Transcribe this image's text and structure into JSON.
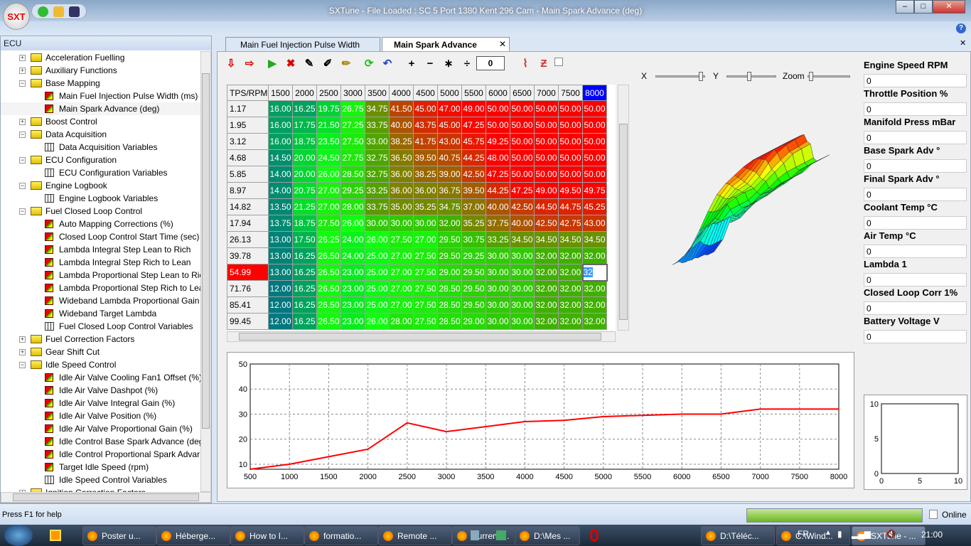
{
  "window": {
    "title": "SXTune - File Loaded :    SC 5 Port 1380 Kent 296 Cam - Main Spark Advance (deg)",
    "logo": "SXT",
    "help_icon": "?"
  },
  "left_panel": {
    "header": "ECU",
    "tree": [
      {
        "label": "Acceleration Fuelling",
        "type": "folder",
        "level": 0,
        "expanded": false
      },
      {
        "label": "Auxiliary Functions",
        "type": "folder",
        "level": 0,
        "expanded": false
      },
      {
        "label": "Base Mapping",
        "type": "folder",
        "level": 0,
        "expanded": true
      },
      {
        "label": "Main Fuel Injection Pulse Width (ms)",
        "type": "map",
        "level": 1
      },
      {
        "label": "Main Spark Advance (deg)",
        "type": "map",
        "level": 1,
        "selected": true
      },
      {
        "label": "Boost Control",
        "type": "folder",
        "level": 0,
        "expanded": false
      },
      {
        "label": "Data Acquisition",
        "type": "folder",
        "level": 0,
        "expanded": true
      },
      {
        "label": "Data Acquisition Variables",
        "type": "table",
        "level": 1
      },
      {
        "label": "ECU Configuration",
        "type": "folder",
        "level": 0,
        "expanded": true
      },
      {
        "label": "ECU Configuration Variables",
        "type": "table",
        "level": 1
      },
      {
        "label": "Engine Logbook",
        "type": "folder",
        "level": 0,
        "expanded": true
      },
      {
        "label": "Engine Logbook Variables",
        "type": "table",
        "level": 1
      },
      {
        "label": "Fuel Closed Loop Control",
        "type": "folder",
        "level": 0,
        "expanded": true
      },
      {
        "label": "Auto Mapping Corrections (%)",
        "type": "map",
        "level": 1
      },
      {
        "label": "Closed Loop Control Start Time (sec)",
        "type": "map",
        "level": 1
      },
      {
        "label": "Lambda Integral Step Lean to Rich",
        "type": "map",
        "level": 1
      },
      {
        "label": "Lambda Integral Step Rich to Lean",
        "type": "map",
        "level": 1
      },
      {
        "label": "Lambda Proportional Step Lean to Ric",
        "type": "map",
        "level": 1
      },
      {
        "label": "Lambda Proportional Step Rich to Lea",
        "type": "map",
        "level": 1
      },
      {
        "label": "Wideband Lambda Proportional Gain",
        "type": "map",
        "level": 1
      },
      {
        "label": "Wideband Target Lambda",
        "type": "map",
        "level": 1
      },
      {
        "label": "Fuel Closed Loop Control Variables",
        "type": "table",
        "level": 1
      },
      {
        "label": "Fuel Correction Factors",
        "type": "folder",
        "level": 0,
        "expanded": false
      },
      {
        "label": "Gear Shift Cut",
        "type": "folder",
        "level": 0,
        "expanded": false
      },
      {
        "label": "Idle Speed Control",
        "type": "folder",
        "level": 0,
        "expanded": true
      },
      {
        "label": "Idle Air Valve Cooling Fan1 Offset (%)",
        "type": "map",
        "level": 1
      },
      {
        "label": "Idle Air Valve Dashpot (%)",
        "type": "map",
        "level": 1
      },
      {
        "label": "Idle Air Valve Integral Gain (%)",
        "type": "map",
        "level": 1
      },
      {
        "label": "Idle Air Valve Position (%)",
        "type": "map",
        "level": 1
      },
      {
        "label": "Idle Air Valve Proportional Gain (%)",
        "type": "map",
        "level": 1
      },
      {
        "label": "Idle Control Base Spark Advance (deg",
        "type": "map",
        "level": 1
      },
      {
        "label": "Idle Control Proportional Spark Advar",
        "type": "map",
        "level": 1
      },
      {
        "label": "Target Idle Speed (rpm)",
        "type": "map",
        "level": 1
      },
      {
        "label": "Idle Speed Control Variables",
        "type": "table",
        "level": 1
      },
      {
        "label": "Ignition Correction Factors",
        "type": "folder",
        "level": 0,
        "expanded": false
      }
    ]
  },
  "tabs": [
    {
      "label": "Main Fuel Injection Pulse Width (ms)",
      "active": false
    },
    {
      "label": "Main Spark Advance (deg)",
      "active": true
    }
  ],
  "toolbar": {
    "value": "0",
    "icons": [
      "insert-row-icon",
      "insert-column-icon",
      "play-icon",
      "delete-icon",
      "edit-icon",
      "edit-select-icon",
      "eraser-icon",
      "refresh-icon",
      "undo-icon"
    ],
    "ops": [
      "+",
      "−",
      "∗",
      "÷"
    ]
  },
  "view_controls": {
    "x_label": "X",
    "y_label": "Y",
    "zoom_label": "Zoom"
  },
  "map": {
    "corner": "TPS/RPM",
    "rpm": [
      "1500",
      "2000",
      "2500",
      "3000",
      "3500",
      "4000",
      "4500",
      "5000",
      "5500",
      "6000",
      "6500",
      "7000",
      "7500",
      "8000"
    ],
    "selected_rpm": "8000",
    "selected_tps": "54.99",
    "editing_value": "32",
    "rows": [
      {
        "tps": "1.17",
        "v": [
          "16.00",
          "16.25",
          "19.75",
          "26.75",
          "34.75",
          "41.50",
          "45.00",
          "47.00",
          "49.00",
          "50.00",
          "50.00",
          "50.00",
          "50.00",
          "50.00"
        ]
      },
      {
        "tps": "1.95",
        "v": [
          "16.00",
          "17.75",
          "21.50",
          "27.25",
          "33.75",
          "40.00",
          "43.75",
          "45.00",
          "47.25",
          "50.00",
          "50.00",
          "50.00",
          "50.00",
          "50.00"
        ]
      },
      {
        "tps": "3.12",
        "v": [
          "16.00",
          "18.75",
          "23.50",
          "27.50",
          "33.00",
          "38.25",
          "41.75",
          "43.00",
          "45.75",
          "49.25",
          "50.00",
          "50.00",
          "50.00",
          "50.00"
        ]
      },
      {
        "tps": "4.68",
        "v": [
          "14.50",
          "20.00",
          "24.50",
          "27.75",
          "32.75",
          "36.50",
          "39.50",
          "40.75",
          "44.25",
          "48.00",
          "50.00",
          "50.00",
          "50.00",
          "50.00"
        ]
      },
      {
        "tps": "5.85",
        "v": [
          "14.00",
          "20.00",
          "26.00",
          "28.50",
          "32.75",
          "36.00",
          "38.25",
          "39.00",
          "42.50",
          "47.25",
          "50.00",
          "50.00",
          "50.00",
          "50.00"
        ]
      },
      {
        "tps": "8.97",
        "v": [
          "14.00",
          "20.75",
          "27.00",
          "29.25",
          "33.25",
          "36.00",
          "36.00",
          "36.75",
          "39.50",
          "44.25",
          "47.25",
          "49.00",
          "49.50",
          "49.75"
        ]
      },
      {
        "tps": "14.82",
        "v": [
          "13.50",
          "21.25",
          "27.00",
          "28.00",
          "33.75",
          "35.00",
          "35.25",
          "34.75",
          "37.00",
          "40.00",
          "42.50",
          "44.50",
          "44.75",
          "45.25"
        ]
      },
      {
        "tps": "17.94",
        "v": [
          "13.75",
          "18.75",
          "27.50",
          "26.00",
          "30.00",
          "30.00",
          "30.00",
          "32.00",
          "35.25",
          "37.75",
          "40.00",
          "42.50",
          "42.75",
          "43.00"
        ]
      },
      {
        "tps": "26.13",
        "v": [
          "13.00",
          "17.50",
          "26.25",
          "24.00",
          "26.00",
          "27.50",
          "27.00",
          "29.50",
          "30.75",
          "33.25",
          "34.50",
          "34.50",
          "34.50",
          "34.50"
        ]
      },
      {
        "tps": "39.78",
        "v": [
          "13.00",
          "16.25",
          "26.50",
          "24.00",
          "25.00",
          "27.00",
          "27.50",
          "29.50",
          "29.25",
          "30.00",
          "30.00",
          "32.00",
          "32.00",
          "32.00"
        ]
      },
      {
        "tps": "54.99",
        "v": [
          "13.00",
          "16.25",
          "26.50",
          "23.00",
          "25.00",
          "27.00",
          "27.50",
          "29.00",
          "29.50",
          "30.00",
          "30.00",
          "32.00",
          "32.00",
          "32"
        ]
      },
      {
        "tps": "71.76",
        "v": [
          "12.00",
          "16.25",
          "26.50",
          "23.00",
          "25.00",
          "27.00",
          "27.50",
          "28.50",
          "29.50",
          "30.00",
          "30.00",
          "32.00",
          "32.00",
          "32.00"
        ]
      },
      {
        "tps": "85.41",
        "v": [
          "12.00",
          "16.25",
          "26.50",
          "23.00",
          "25.00",
          "27.00",
          "27.50",
          "28.50",
          "29.50",
          "30.00",
          "30.00",
          "32.00",
          "32.00",
          "32.00"
        ]
      },
      {
        "tps": "99.45",
        "v": [
          "12.00",
          "16.25",
          "26.50",
          "23.00",
          "26.00",
          "28.00",
          "27.50",
          "28.50",
          "29.00",
          "30.00",
          "30.00",
          "32.00",
          "32.00",
          "32.00"
        ]
      }
    ]
  },
  "gauges": [
    {
      "label": "Engine Speed RPM",
      "value": "0"
    },
    {
      "label": "Throttle Position %",
      "value": "0"
    },
    {
      "label": "Manifold Press mBar",
      "value": "0"
    },
    {
      "label": "Base Spark Adv °",
      "value": "0"
    },
    {
      "label": "Final Spark Adv °",
      "value": "0"
    },
    {
      "label": "Coolant Temp °C",
      "value": "0"
    },
    {
      "label": "Air Temp °C",
      "value": "0"
    },
    {
      "label": "Lambda 1",
      "value": "0"
    },
    {
      "label": "Closed Loop Corr 1%",
      "value": "0"
    },
    {
      "label": "Battery Voltage V",
      "value": "0"
    }
  ],
  "chart_data": [
    {
      "type": "line",
      "x": [
        500,
        1000,
        1500,
        2000,
        2500,
        3000,
        3500,
        4000,
        4500,
        5000,
        5500,
        6000,
        6500,
        7000,
        7500,
        8000
      ],
      "series": [
        {
          "values": [
            8,
            10,
            13,
            16,
            26.5,
            23,
            25,
            27,
            27.5,
            29,
            29.5,
            30,
            30,
            32,
            32,
            32
          ],
          "color": "#ff0000"
        }
      ],
      "xticks": [
        "500",
        "1000",
        "1500",
        "2000",
        "2500",
        "3000",
        "3500",
        "4000",
        "4500",
        "5000",
        "5500",
        "6000",
        "6500",
        "7000",
        "7500",
        "8000"
      ],
      "yticks": [
        "10",
        "20",
        "30",
        "40",
        "50"
      ],
      "xlim": [
        500,
        8000
      ],
      "ylim": [
        8,
        50
      ],
      "grid": true
    },
    {
      "type": "line",
      "x": [],
      "series": [],
      "xticks": [
        "0",
        "5",
        "10"
      ],
      "yticks": [
        "0",
        "5",
        "10"
      ],
      "xlim": [
        0,
        10
      ],
      "ylim": [
        0,
        10
      ],
      "grid": false
    }
  ],
  "status": {
    "help": "Press F1 for help",
    "progress": 1.0,
    "online_label": "Online",
    "online": false
  },
  "taskbar": {
    "items": [
      "Poster u...",
      "Héberge...",
      "How to I...",
      "formatio...",
      "Remote ...",
      "Current ...",
      "D:\\Mes ...",
      "D:\\Téléc...",
      "C:\\Wind...",
      "SXTune - ..."
    ],
    "lang": "FR",
    "clock": "21:00"
  }
}
